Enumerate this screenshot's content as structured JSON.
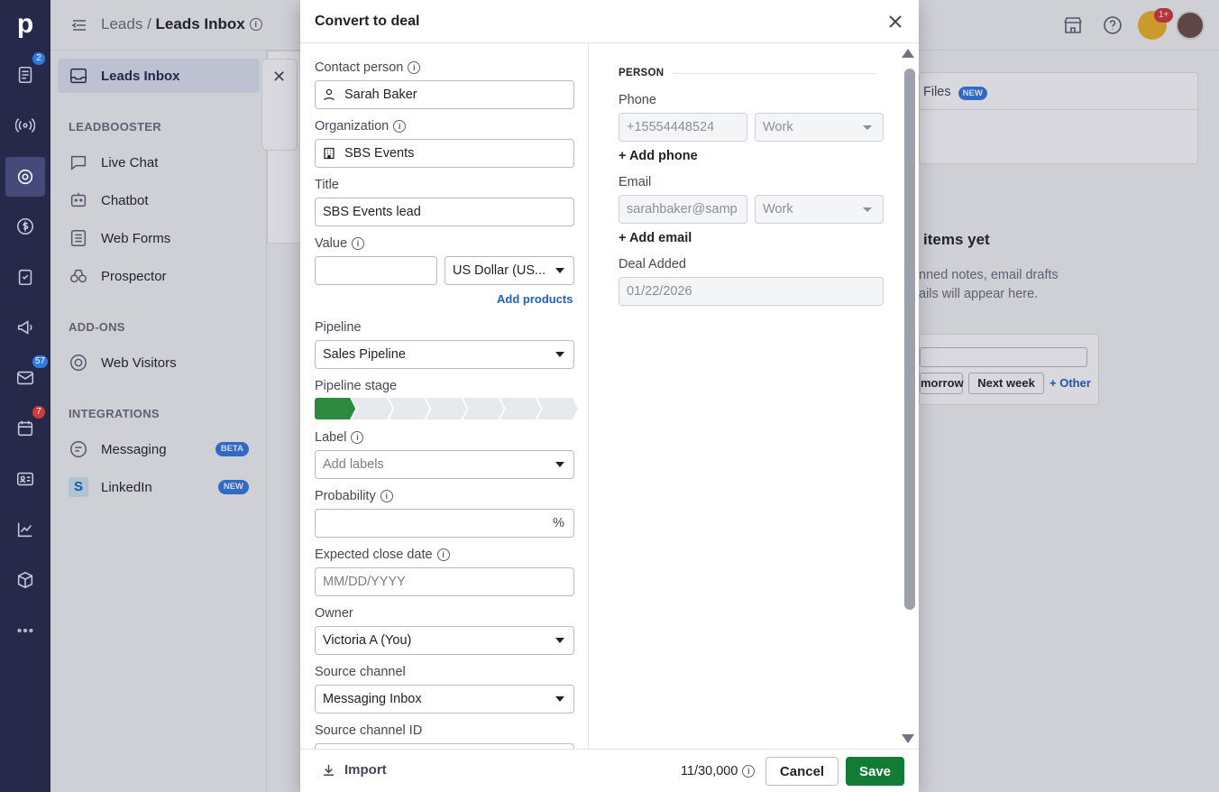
{
  "header": {
    "crumb_parent": "Leads",
    "crumb_sep": "/",
    "crumb_current": "Leads Inbox"
  },
  "rail": {
    "badges": {
      "leads": "2",
      "mail": "57",
      "activities": "7"
    },
    "notif_badge": "1+"
  },
  "sidebar": {
    "inbox": "Leads Inbox",
    "sec_leadbooster": "LEADBOOSTER",
    "live_chat": "Live Chat",
    "chatbot": "Chatbot",
    "web_forms": "Web Forms",
    "prospector": "Prospector",
    "sec_addons": "ADD-ONS",
    "web_visitors": "Web Visitors",
    "sec_integrations": "INTEGRATIONS",
    "messaging": "Messaging",
    "messaging_pill": "BETA",
    "linkedin": "LinkedIn",
    "linkedin_pill": "NEW"
  },
  "background": {
    "files_tab": "Files",
    "files_pill": "NEW",
    "empty_title": "items yet",
    "empty_line1": "nned notes, email drafts",
    "empty_line2": "ails will appear here.",
    "quick_tomorrow": "morrow",
    "quick_next_week": "Next week",
    "quick_other": "+ Other"
  },
  "modal": {
    "title": "Convert to deal",
    "contact_label": "Contact person",
    "contact_value": "Sarah Baker",
    "org_label": "Organization",
    "org_value": "SBS Events",
    "title_label": "Title",
    "title_value": "SBS Events lead",
    "value_label": "Value",
    "value_amount": "",
    "currency": "US Dollar (US...",
    "add_products": "Add products",
    "pipeline_label": "Pipeline",
    "pipeline_value": "Sales Pipeline",
    "stage_label": "Pipeline stage",
    "stage_total": 7,
    "stage_current": 1,
    "label_label": "Label",
    "label_placeholder": "Add labels",
    "prob_label": "Probability",
    "prob_unit": "%",
    "close_label": "Expected close date",
    "close_placeholder": "MM/DD/YYYY",
    "owner_label": "Owner",
    "owner_value": "Victoria A (You)",
    "source_label": "Source channel",
    "source_value": "Messaging Inbox",
    "source_id_label": "Source channel ID",
    "person_title": "PERSON",
    "phone_label": "Phone",
    "phone_value": "+15554448524",
    "phone_type": "Work",
    "add_phone": "+ Add phone",
    "email_label": "Email",
    "email_value": "sarahbaker@samp",
    "email_type": "Work",
    "add_email": "+ Add email",
    "deal_added_label": "Deal Added",
    "deal_added_value": "01/22/2026",
    "import": "Import",
    "counter": "11/30,000",
    "cancel": "Cancel",
    "save": "Save"
  },
  "colors": {
    "rail": "#26294a",
    "save": "#127b35",
    "stage_active": "#2b8a3e",
    "link": "#1f5fc4",
    "badge_blue": "#317ae2",
    "badge_red": "#d03a3a"
  }
}
